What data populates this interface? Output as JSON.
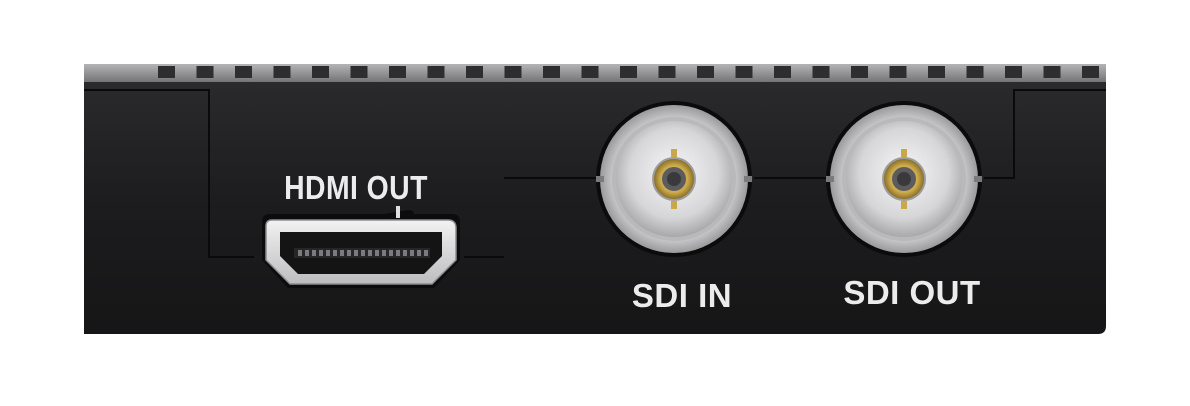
{
  "device": {
    "ports": [
      {
        "id": "hdmi",
        "label": "HDMI OUT",
        "icon": "hdmi-port-icon"
      },
      {
        "id": "sdi_in",
        "label": "SDI IN",
        "icon": "bnc-connector-icon"
      },
      {
        "id": "sdi_out",
        "label": "SDI OUT",
        "icon": "bnc-connector-icon"
      }
    ],
    "colors": {
      "body": "#1d1d1f",
      "vent_strip": "#8a8a8c",
      "label": "#ececec",
      "bnc_metal": "#d9d9db",
      "bnc_pin": "#c9a84a"
    }
  }
}
